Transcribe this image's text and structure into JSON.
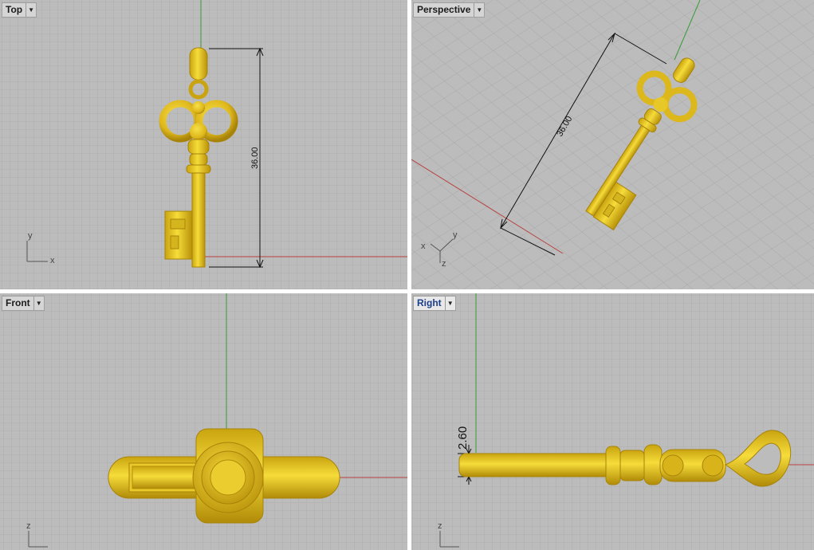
{
  "viewports": {
    "top": {
      "name": "Top",
      "axis_x": "x",
      "axis_y": "y",
      "dimension": "36.00"
    },
    "perspective": {
      "name": "Perspective",
      "axis_x": "x",
      "axis_y": "y",
      "axis_z": "z",
      "dimension": "36.00"
    },
    "front": {
      "name": "Front",
      "axis_z": "z"
    },
    "right": {
      "name": "Right",
      "axis_z": "z",
      "dimension": "2.60",
      "active": true
    }
  },
  "dropdown_icon": "chevron-down-icon",
  "colors": {
    "viewport_bg": "#bcbcbc",
    "grid_minor": "#aeaeae",
    "grid_major": "#9a9a9a",
    "x_axis": "#b84040",
    "y_axis": "#3a9a3a",
    "gold": "#e6c320",
    "gold_dark": "#b28e0a",
    "active_label": "#1c3e8a"
  }
}
